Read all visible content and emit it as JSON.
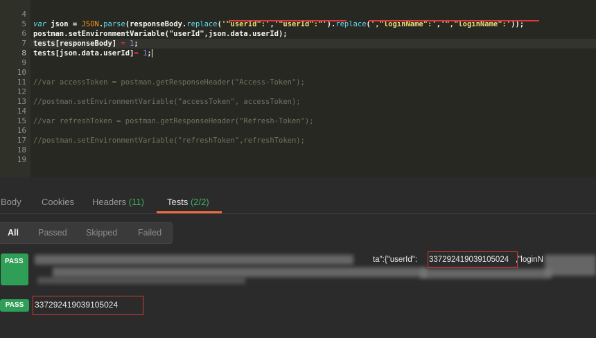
{
  "editor": {
    "line_numbers": [
      "4",
      "5",
      "6",
      "7",
      "8",
      "9",
      "10",
      "11",
      "12",
      "13",
      "14",
      "15",
      "16",
      "17",
      "18",
      "19"
    ],
    "lines": {
      "l5": {
        "kw": "var",
        "ident": " json = ",
        "obj": "JSON",
        "dot1": ".",
        "fn_parse": "parse",
        "p1": "(responseBody.",
        "fn_replace1": "replace",
        "p2": "(",
        "s1": "'\"userId\":'",
        "c1": ",",
        "s2": "'\"userId\":\"'",
        "p3": ").",
        "fn_replace2": "replace",
        "p4": "(",
        "s3": "',\"loginName\":'",
        "c2": ",",
        "s4": "'\",\"loginName\":'",
        "p5": "));"
      },
      "l6": "postman.setEnvironmentVariable(\"userId\",json.data.userId);",
      "l7": {
        "a": "tests[responseBody] ",
        "op": "=",
        "sp": " ",
        "num": "1",
        "end": ";"
      },
      "l8": {
        "a": "tests[json.data.userId]",
        "op": "=",
        "sp": " ",
        "num": "1",
        "end": ";"
      },
      "l11": "//var accessToken = postman.getResponseHeader(\"Access-Token\");",
      "l13": "//postman.setEnvironmentVariable(\"accessToken\", accessToken);",
      "l15": "//var refreshToken = postman.getResponseHeader(\"Refresh-Token\");",
      "l17": "//postman.setEnvironmentVariable(\"refreshToken\",refreshToken);"
    }
  },
  "response_tabs": {
    "body": "Body",
    "cookies": "Cookies",
    "headers_label": "Headers",
    "headers_count": "(11)",
    "tests_label": "Tests",
    "tests_count": "(2/2)"
  },
  "filters": {
    "all": "All",
    "passed": "Passed",
    "skipped": "Skipped",
    "failed": "Failed"
  },
  "results": [
    {
      "status": "PASS",
      "prefix_text": "ta\":{\"userId\":",
      "user_id": "337292419039105024",
      "suffix_text": ",\"loginN"
    },
    {
      "status": "PASS",
      "value": "337292419039105024"
    }
  ],
  "colors": {
    "accent": "#f26b3a",
    "pass": "#2f9e56",
    "count": "#3fb05e",
    "highlight": "#d23a3a"
  }
}
